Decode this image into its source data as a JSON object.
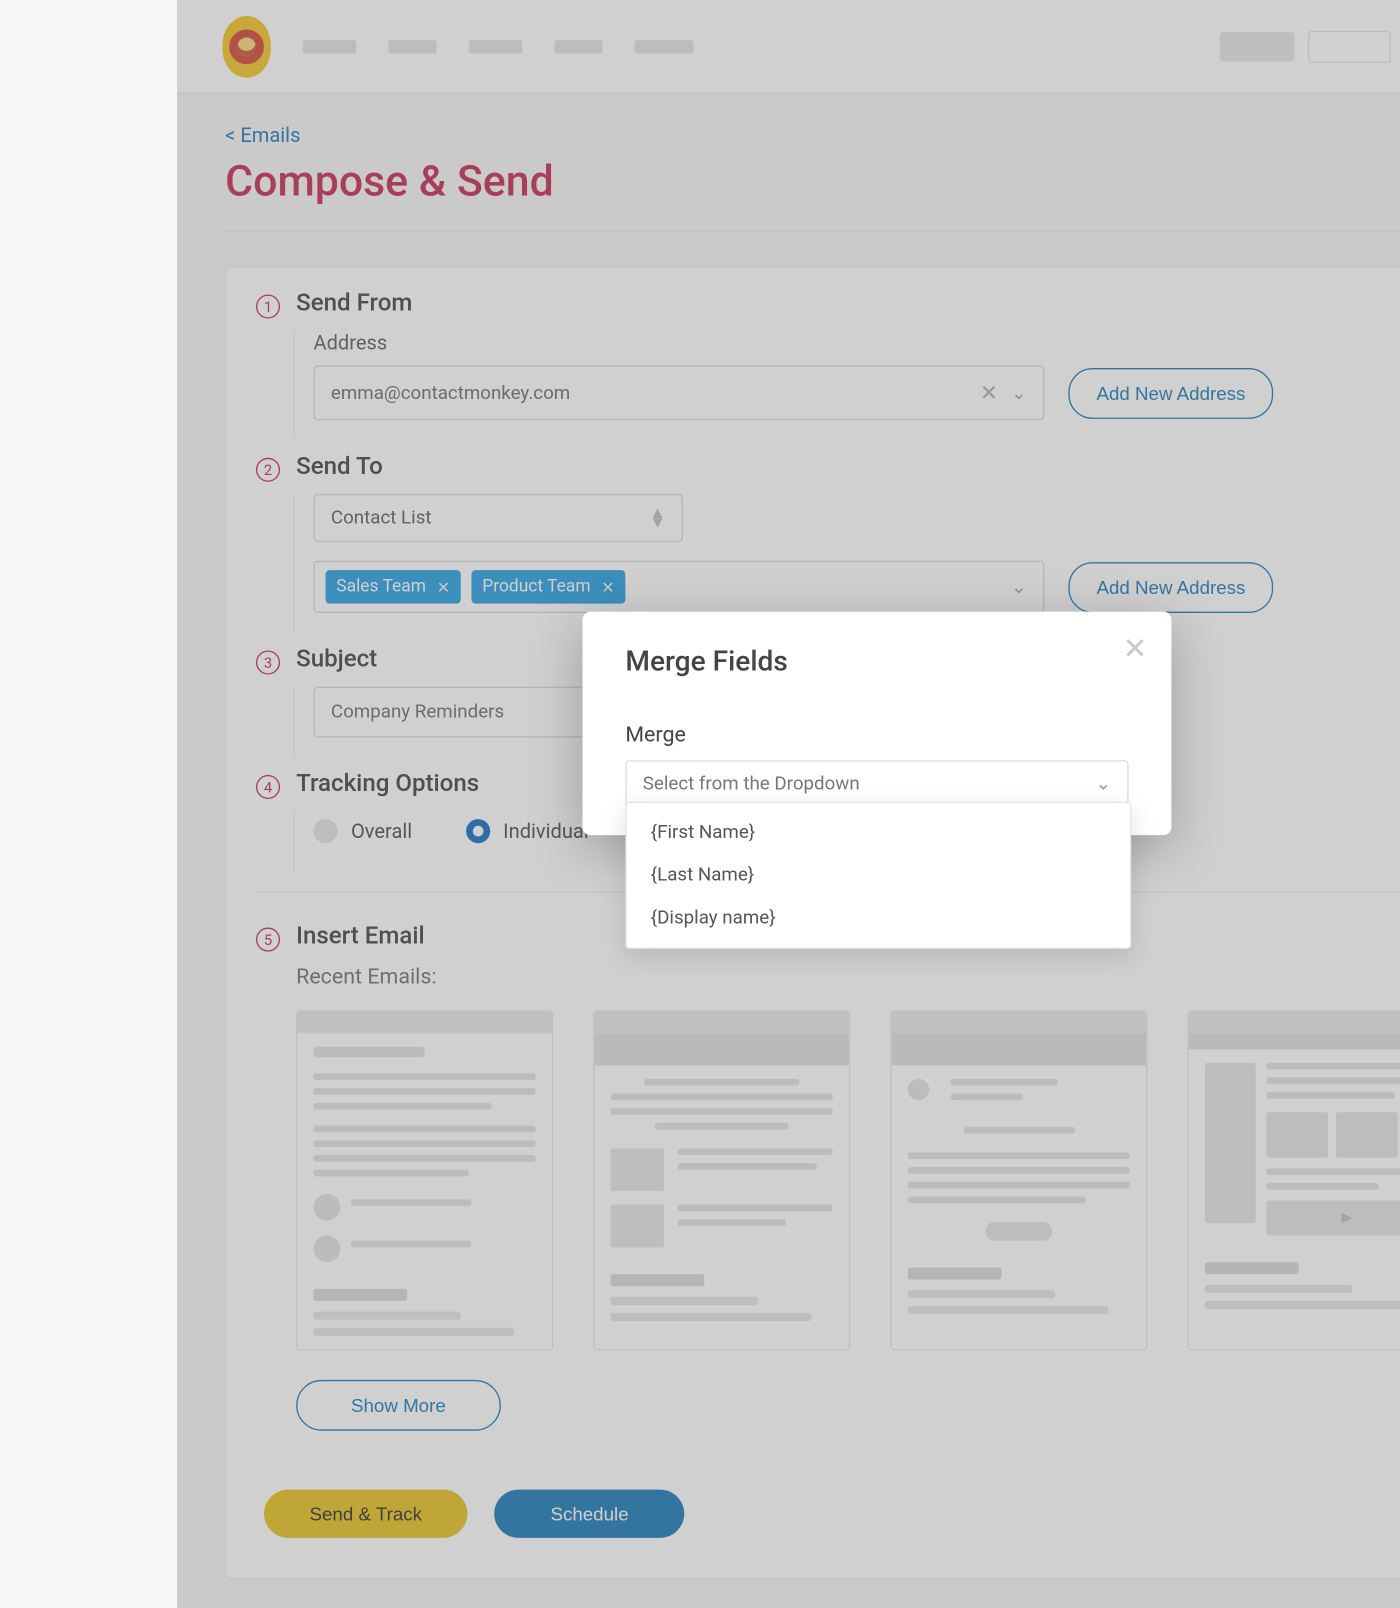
{
  "breadcrumb": "< Emails",
  "page_title": "Compose & Send",
  "steps": {
    "1": {
      "title": "Send From",
      "address_label": "Address",
      "address_value": "emma@contactmonkey.com",
      "add_btn": "Add New Address"
    },
    "2": {
      "title": "Send To",
      "list_label": "Contact List",
      "chips": [
        "Sales Team",
        "Product Team"
      ],
      "add_btn": "Add New Address"
    },
    "3": {
      "title": "Subject",
      "value": "Company Reminders"
    },
    "4": {
      "title": "Tracking Options",
      "opt_overall": "Overall",
      "opt_individual": "Individual"
    },
    "5": {
      "title": "Insert Email",
      "recent_label": "Recent Emails:",
      "show_more": "Show More"
    }
  },
  "footer": {
    "send": "Send & Track",
    "schedule": "Schedule"
  },
  "modal": {
    "title": "Merge Fields",
    "field_label": "Merge",
    "placeholder": "Select from the Dropdown",
    "options": [
      "{First Name}",
      "{Last Name}",
      "{Display name}"
    ]
  }
}
